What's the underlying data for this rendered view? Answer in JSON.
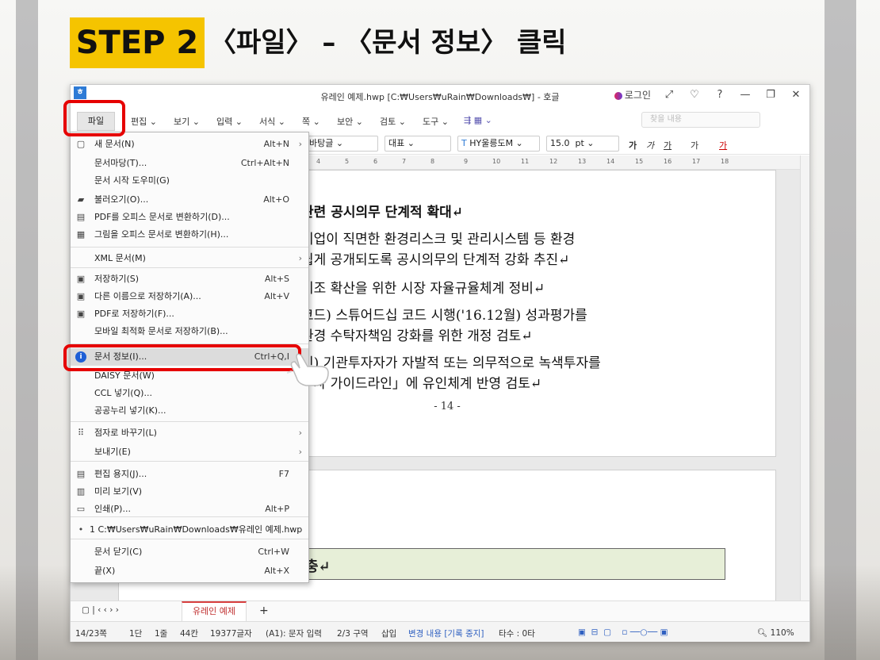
{
  "banner": {
    "step": "STEP 2",
    "title": "〈파일〉 – 〈문서 정보〉 클릭"
  },
  "window": {
    "logo": "ㅎ",
    "title": "유레인 예제.hwp [C:₩Users₩uRain₩Downloads₩] - 호글",
    "login": "로그인",
    "controls": [
      "⤢",
      "♡",
      "?",
      "—",
      "❐",
      "✕"
    ]
  },
  "menubar": {
    "file": "파일",
    "items": [
      "편집 ⌄",
      "보기 ⌄",
      "입력 ⌄",
      "서식 ⌄",
      "쪽 ⌄",
      "보안 ⌄",
      "검토 ⌄",
      "도구 ⌄"
    ],
    "search_placeholder": "찾을 내용"
  },
  "toolbar": {
    "font_face": "바탕글",
    "style": "대표",
    "font_name": "HY울릉도M",
    "font_size": "15.0",
    "unit": "pt",
    "format_buttons": [
      "가",
      "가",
      "가",
      "가"
    ]
  },
  "ruler": {
    "ticks": [
      "4",
      "5",
      "6",
      "7",
      "8",
      "9",
      "10",
      "11",
      "12",
      "13",
      "14",
      "15",
      "16",
      "17",
      "18"
    ]
  },
  "document": {
    "lines": [
      "관련 공시의무 단계적 확대↵",
      "기업이 직면한 환경리스크 및 관리시스템 등 환경",
      "쉽게 공개되도록 공시의무의 단계적 강화 추진↵",
      "기조 확산을 위한 시장 자율규율체계 정비↵",
      "코드) 스튜어드십 코드 시행('16.12월) 성과평가를",
      "환경 수탁자책임 강화를 위한 개정 검토↵",
      "인) 기관투자자가 자발적 또는 의무적으로 녹색투자를",
      "투자 가이드라인」에 유인체계 반영 검토↵"
    ],
    "page_number": "- 14 -",
    "page2_text": "충↵"
  },
  "tabs": {
    "doc_tab": "유레인 예제",
    "add": "+"
  },
  "status": {
    "page": "14/23쪽",
    "column": "1단",
    "line": "1줄",
    "chars": "44칸",
    "total": "19377글자",
    "mode": "(A1): 문자 입력",
    "section": "2/3 구역",
    "insert": "삽입",
    "track": "변경 내용 [기록 중지]",
    "typing": "타수 : 0타",
    "zoom": "110%"
  },
  "file_menu": {
    "items": [
      {
        "icon": "new-doc-icon",
        "glyph": "▢",
        "label": "새 문서(N)",
        "shortcut": "Alt+N",
        "arrow": "›"
      },
      {
        "icon": "",
        "glyph": "",
        "label": "문서마당(T)...",
        "shortcut": "Ctrl+Alt+N",
        "arrow": ""
      },
      {
        "icon": "",
        "glyph": "",
        "label": "문서 시작 도우미(G)",
        "shortcut": "",
        "arrow": ""
      },
      {
        "icon": "folder-icon",
        "glyph": "▰",
        "label": "불러오기(O)...",
        "shortcut": "Alt+O",
        "arrow": ""
      },
      {
        "icon": "pdf-icon",
        "glyph": "▤",
        "label": "PDF를 오피스 문서로 변환하기(D)...",
        "shortcut": "",
        "arrow": ""
      },
      {
        "icon": "image-convert-icon",
        "glyph": "▦",
        "label": "그림을 오피스 문서로 변환하기(H)...",
        "shortcut": "",
        "arrow": ""
      },
      {
        "icon": "",
        "glyph": "",
        "label": "XML 문서(M)",
        "shortcut": "",
        "arrow": "›"
      },
      {
        "icon": "save-icon",
        "glyph": "▣",
        "label": "저장하기(S)",
        "shortcut": "Alt+S",
        "arrow": ""
      },
      {
        "icon": "save-as-icon",
        "glyph": "▣",
        "label": "다른 이름으로 저장하기(A)...",
        "shortcut": "Alt+V",
        "arrow": ""
      },
      {
        "icon": "pdf-save-icon",
        "glyph": "▣",
        "label": "PDF로 저장하기(F)...",
        "shortcut": "",
        "arrow": ""
      },
      {
        "icon": "",
        "glyph": "",
        "label": "모바일 최적화 문서로 저장하기(B)...",
        "shortcut": "",
        "arrow": ""
      },
      {
        "icon": "info-icon",
        "glyph": "i",
        "label": "문서 정보(I)...",
        "shortcut": "Ctrl+Q,I",
        "arrow": ""
      },
      {
        "icon": "",
        "glyph": "",
        "label": "DAISY 문서(W)",
        "shortcut": "",
        "arrow": ""
      },
      {
        "icon": "",
        "glyph": "",
        "label": "CCL 넣기(Q)...",
        "shortcut": "",
        "arrow": ""
      },
      {
        "icon": "",
        "glyph": "",
        "label": "공공누리 넣기(K)...",
        "shortcut": "",
        "arrow": ""
      },
      {
        "icon": "braille-icon",
        "glyph": "⠿",
        "label": "점자로 바꾸기(L)",
        "shortcut": "",
        "arrow": "›"
      },
      {
        "icon": "",
        "glyph": "",
        "label": "보내기(E)",
        "shortcut": "",
        "arrow": "›"
      },
      {
        "icon": "page-setup-icon",
        "glyph": "▤",
        "label": "편집 용지(J)...",
        "shortcut": "F7",
        "arrow": ""
      },
      {
        "icon": "preview-icon",
        "glyph": "▥",
        "label": "미리 보기(V)",
        "shortcut": "",
        "arrow": ""
      },
      {
        "icon": "print-icon",
        "glyph": "▭",
        "label": "인쇄(P)...",
        "shortcut": "Alt+P",
        "arrow": ""
      },
      {
        "icon": "recent-file-icon",
        "glyph": "•",
        "label": "1 C:₩Users₩uRain₩Downloads₩유레인 예제.hwp",
        "shortcut": "",
        "arrow": ""
      },
      {
        "icon": "",
        "glyph": "",
        "label": "문서 닫기(C)",
        "shortcut": "Ctrl+W",
        "arrow": ""
      },
      {
        "icon": "",
        "glyph": "",
        "label": "끝(X)",
        "shortcut": "Alt+X",
        "arrow": ""
      }
    ]
  },
  "colors": {
    "badge": "#f5c400",
    "highlight": "#e60000",
    "info_icon": "#1e5fd6"
  }
}
